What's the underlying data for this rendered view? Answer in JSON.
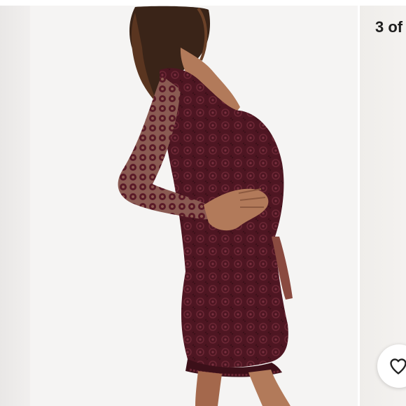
{
  "carousel": {
    "counter_label": "3 of",
    "current_photo": "burgundy-lace-mini-dress-side-view"
  },
  "actions": {
    "like_icon": "heart-outline-icon"
  },
  "colors": {
    "background": "#f3f1f1",
    "dress": "#4e1622",
    "skin": "#b27a5a",
    "hair": "#3a2418"
  }
}
